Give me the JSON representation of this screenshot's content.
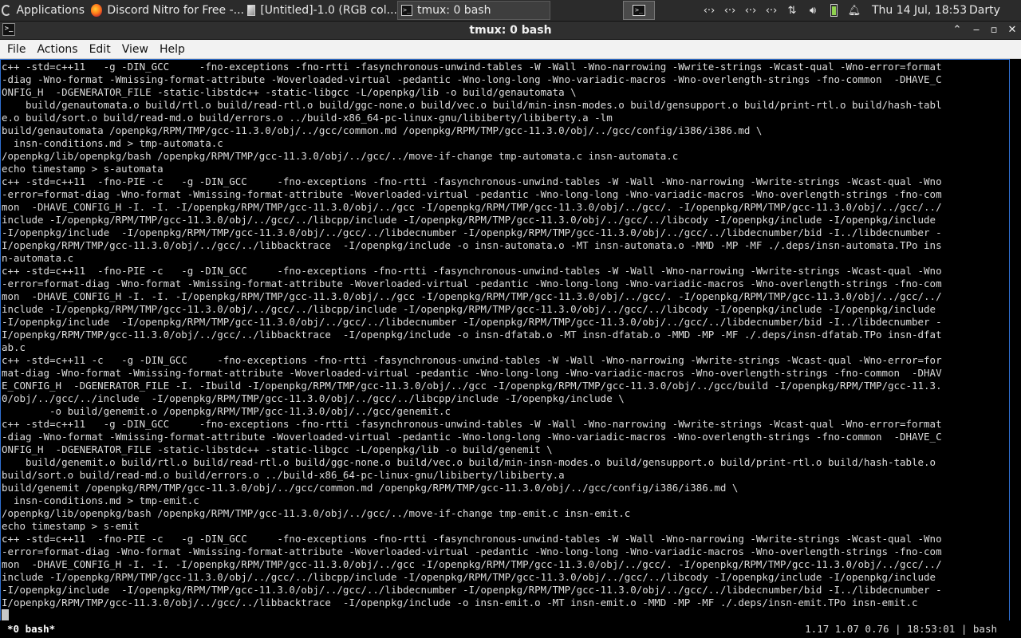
{
  "panel": {
    "applications_label": "Applications",
    "tasks": [
      {
        "label": "Discord Nitro for Free -..."
      },
      {
        "label": "[Untitled]-1.0 (RGB col..."
      },
      {
        "label": "tmux: 0 bash"
      }
    ],
    "clock": "Thu 14 Jul, 18:53",
    "user": "Darty uwu"
  },
  "window": {
    "title": "tmux: 0 bash",
    "menu": [
      "File",
      "Actions",
      "Edit",
      "View",
      "Help"
    ]
  },
  "terminal": {
    "lines": [
      "c++ -std=c++11   -g -DIN_GCC     -fno-exceptions -fno-rtti -fasynchronous-unwind-tables -W -Wall -Wno-narrowing -Wwrite-strings -Wcast-qual -Wno-error=format",
      "-diag -Wno-format -Wmissing-format-attribute -Woverloaded-virtual -pedantic -Wno-long-long -Wno-variadic-macros -Wno-overlength-strings -fno-common  -DHAVE_C",
      "ONFIG_H  -DGENERATOR_FILE -static-libstdc++ -static-libgcc -L/openpkg/lib -o build/genautomata \\",
      "    build/genautomata.o build/rtl.o build/read-rtl.o build/ggc-none.o build/vec.o build/min-insn-modes.o build/gensupport.o build/print-rtl.o build/hash-tabl",
      "e.o build/sort.o build/read-md.o build/errors.o ../build-x86_64-pc-linux-gnu/libiberty/libiberty.a -lm",
      "build/genautomata /openpkg/RPM/TMP/gcc-11.3.0/obj/../gcc/common.md /openpkg/RPM/TMP/gcc-11.3.0/obj/../gcc/config/i386/i386.md \\",
      "  insn-conditions.md > tmp-automata.c",
      "/openpkg/lib/openpkg/bash /openpkg/RPM/TMP/gcc-11.3.0/obj/../gcc/../move-if-change tmp-automata.c insn-automata.c",
      "echo timestamp > s-automata",
      "c++ -std=c++11  -fno-PIE -c   -g -DIN_GCC     -fno-exceptions -fno-rtti -fasynchronous-unwind-tables -W -Wall -Wno-narrowing -Wwrite-strings -Wcast-qual -Wno",
      "-error=format-diag -Wno-format -Wmissing-format-attribute -Woverloaded-virtual -pedantic -Wno-long-long -Wno-variadic-macros -Wno-overlength-strings -fno-com",
      "mon  -DHAVE_CONFIG_H -I. -I. -I/openpkg/RPM/TMP/gcc-11.3.0/obj/../gcc -I/openpkg/RPM/TMP/gcc-11.3.0/obj/../gcc/. -I/openpkg/RPM/TMP/gcc-11.3.0/obj/../gcc/../",
      "include -I/openpkg/RPM/TMP/gcc-11.3.0/obj/../gcc/../libcpp/include -I/openpkg/RPM/TMP/gcc-11.3.0/obj/../gcc/../libcody -I/openpkg/include -I/openpkg/include",
      "-I/openpkg/include  -I/openpkg/RPM/TMP/gcc-11.3.0/obj/../gcc/../libdecnumber -I/openpkg/RPM/TMP/gcc-11.3.0/obj/../gcc/../libdecnumber/bid -I../libdecnumber -",
      "I/openpkg/RPM/TMP/gcc-11.3.0/obj/../gcc/../libbacktrace  -I/openpkg/include -o insn-automata.o -MT insn-automata.o -MMD -MP -MF ./.deps/insn-automata.TPo ins",
      "n-automata.c",
      "c++ -std=c++11  -fno-PIE -c   -g -DIN_GCC     -fno-exceptions -fno-rtti -fasynchronous-unwind-tables -W -Wall -Wno-narrowing -Wwrite-strings -Wcast-qual -Wno",
      "-error=format-diag -Wno-format -Wmissing-format-attribute -Woverloaded-virtual -pedantic -Wno-long-long -Wno-variadic-macros -Wno-overlength-strings -fno-com",
      "mon  -DHAVE_CONFIG_H -I. -I. -I/openpkg/RPM/TMP/gcc-11.3.0/obj/../gcc -I/openpkg/RPM/TMP/gcc-11.3.0/obj/../gcc/. -I/openpkg/RPM/TMP/gcc-11.3.0/obj/../gcc/../",
      "include -I/openpkg/RPM/TMP/gcc-11.3.0/obj/../gcc/../libcpp/include -I/openpkg/RPM/TMP/gcc-11.3.0/obj/../gcc/../libcody -I/openpkg/include -I/openpkg/include",
      "-I/openpkg/include  -I/openpkg/RPM/TMP/gcc-11.3.0/obj/../gcc/../libdecnumber -I/openpkg/RPM/TMP/gcc-11.3.0/obj/../gcc/../libdecnumber/bid -I../libdecnumber -",
      "I/openpkg/RPM/TMP/gcc-11.3.0/obj/../gcc/../libbacktrace  -I/openpkg/include -o insn-dfatab.o -MT insn-dfatab.o -MMD -MP -MF ./.deps/insn-dfatab.TPo insn-dfat",
      "ab.c",
      "c++ -std=c++11 -c   -g -DIN_GCC     -fno-exceptions -fno-rtti -fasynchronous-unwind-tables -W -Wall -Wno-narrowing -Wwrite-strings -Wcast-qual -Wno-error=for",
      "mat-diag -Wno-format -Wmissing-format-attribute -Woverloaded-virtual -pedantic -Wno-long-long -Wno-variadic-macros -Wno-overlength-strings -fno-common  -DHAV",
      "E_CONFIG_H  -DGENERATOR_FILE -I. -Ibuild -I/openpkg/RPM/TMP/gcc-11.3.0/obj/../gcc -I/openpkg/RPM/TMP/gcc-11.3.0/obj/../gcc/build -I/openpkg/RPM/TMP/gcc-11.3.",
      "0/obj/../gcc/../include  -I/openpkg/RPM/TMP/gcc-11.3.0/obj/../gcc/../libcpp/include -I/openpkg/include \\",
      "        -o build/genemit.o /openpkg/RPM/TMP/gcc-11.3.0/obj/../gcc/genemit.c",
      "c++ -std=c++11   -g -DIN_GCC     -fno-exceptions -fno-rtti -fasynchronous-unwind-tables -W -Wall -Wno-narrowing -Wwrite-strings -Wcast-qual -Wno-error=format",
      "-diag -Wno-format -Wmissing-format-attribute -Woverloaded-virtual -pedantic -Wno-long-long -Wno-variadic-macros -Wno-overlength-strings -fno-common  -DHAVE_C",
      "ONFIG_H  -DGENERATOR_FILE -static-libstdc++ -static-libgcc -L/openpkg/lib -o build/genemit \\",
      "    build/genemit.o build/rtl.o build/read-rtl.o build/ggc-none.o build/vec.o build/min-insn-modes.o build/gensupport.o build/print-rtl.o build/hash-table.o",
      "build/sort.o build/read-md.o build/errors.o ../build-x86_64-pc-linux-gnu/libiberty/libiberty.a",
      "build/genemit /openpkg/RPM/TMP/gcc-11.3.0/obj/../gcc/common.md /openpkg/RPM/TMP/gcc-11.3.0/obj/../gcc/config/i386/i386.md \\",
      "  insn-conditions.md > tmp-emit.c",
      "/openpkg/lib/openpkg/bash /openpkg/RPM/TMP/gcc-11.3.0/obj/../gcc/../move-if-change tmp-emit.c insn-emit.c",
      "echo timestamp > s-emit",
      "c++ -std=c++11  -fno-PIE -c   -g -DIN_GCC     -fno-exceptions -fno-rtti -fasynchronous-unwind-tables -W -Wall -Wno-narrowing -Wwrite-strings -Wcast-qual -Wno",
      "-error=format-diag -Wno-format -Wmissing-format-attribute -Woverloaded-virtual -pedantic -Wno-long-long -Wno-variadic-macros -Wno-overlength-strings -fno-com",
      "mon  -DHAVE_CONFIG_H -I. -I. -I/openpkg/RPM/TMP/gcc-11.3.0/obj/../gcc -I/openpkg/RPM/TMP/gcc-11.3.0/obj/../gcc/. -I/openpkg/RPM/TMP/gcc-11.3.0/obj/../gcc/../",
      "include -I/openpkg/RPM/TMP/gcc-11.3.0/obj/../gcc/../libcpp/include -I/openpkg/RPM/TMP/gcc-11.3.0/obj/../gcc/../libcody -I/openpkg/include -I/openpkg/include",
      "-I/openpkg/include  -I/openpkg/RPM/TMP/gcc-11.3.0/obj/../gcc/../libdecnumber -I/openpkg/RPM/TMP/gcc-11.3.0/obj/../gcc/../libdecnumber/bid -I../libdecnumber -",
      "I/openpkg/RPM/TMP/gcc-11.3.0/obj/../gcc/../libbacktrace  -I/openpkg/include -o insn-emit.o -MT insn-emit.o -MMD -MP -MF ./.deps/insn-emit.TPo insn-emit.c"
    ]
  },
  "tmux_status": {
    "window": "*0 bash*",
    "load": "1.17 1.07 0.76",
    "time": "18:53:01",
    "command": "bash"
  },
  "icons": {
    "applications": "debian-swirl-icon",
    "browser": "firefox-icon",
    "gimp": "image-editor-icon",
    "terminal": "terminal-icon",
    "network": "network-arrows-icon",
    "transfer": "up-down-arrows-icon",
    "volume": "speaker-icon",
    "battery": "battery-icon",
    "notifications": "bell-icon"
  },
  "colors": {
    "panel_bg": "#2b2b2b",
    "terminal_bg": "#000000",
    "terminal_fg": "#dcdcdc",
    "focus_border": "#2f6fd0",
    "battery": "#8fd14f"
  }
}
